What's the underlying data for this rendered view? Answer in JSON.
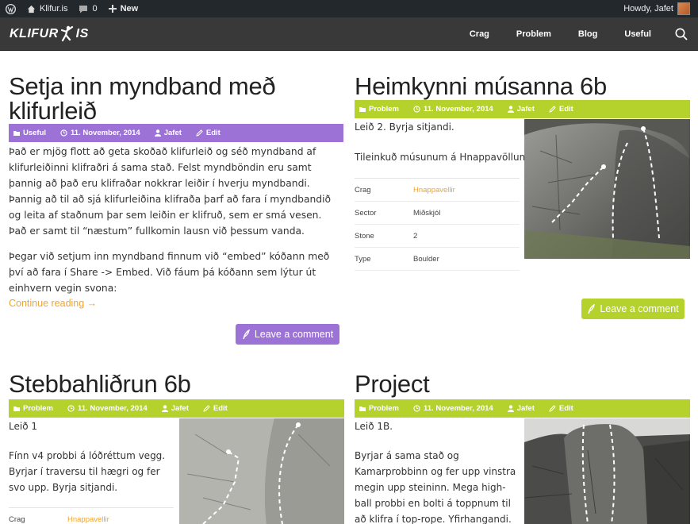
{
  "adminbar": {
    "site": "Klifur.is",
    "comments_count": "0",
    "new_label": "New",
    "greeting": "Howdy, Jafet"
  },
  "nav": {
    "logo_left": "KLIFUR",
    "logo_right": "IS",
    "items": [
      {
        "label": "Crag"
      },
      {
        "label": "Problem"
      },
      {
        "label": "Blog"
      },
      {
        "label": "Useful"
      }
    ]
  },
  "posts": [
    {
      "title": "Setja inn myndband með klifurleið",
      "category": "Useful",
      "date": "11. November, 2014",
      "author": "Jafet",
      "edit": "Edit",
      "paragraphs": [
        "Það er mjög flott að geta skoðað klifurleið og séð myndband af klifurleiðinni klifraðri á sama stað. Felst myndböndin eru samt þannig að það eru klifraðar nokkrar leiðir í hverju myndbandi. Þannig að til að sjá klifurleiðina klifraða þarf að fara í myndbandið og leita af staðnum þar sem leiðin er klifruð, sem er smá vesen. Það er samt til “næstum” fullkomin lausn við þessum vanda.",
        "Þegar við setjum inn myndband finnum við “embed” kóðann með því að fara í Share -> Embed. Við fáum þá kóðann sem lýtur út einhvern vegin svona:"
      ],
      "continue": "Continue reading →",
      "comment_button": "Leave a comment"
    },
    {
      "title": "Heimkynni músanna 6b",
      "category": "Problem",
      "date": "11. November, 2014",
      "author": "Jafet",
      "edit": "Edit",
      "paragraphs": [
        "Leið 2. Byrja sitjandi.",
        "Tileinkuð músunum á Hnappavöllum."
      ],
      "attributes": [
        {
          "key": "Crag",
          "value": "Hnappavellir"
        },
        {
          "key": "Sector",
          "value": "Miðskjól"
        },
        {
          "key": "Stone",
          "value": "2"
        },
        {
          "key": "Type",
          "value": "Boulder"
        }
      ],
      "comment_button": "Leave a comment"
    },
    {
      "title": "Stebbahliðrun 6b",
      "category": "Problem",
      "date": "11. November, 2014",
      "author": "Jafet",
      "edit": "Edit",
      "paragraphs": [
        "Leið 1",
        "Fínn v4 probbi á lóðréttum vegg. Byrjar í traversu til hægri og fer svo upp. Byrja sitjandi."
      ],
      "attributes": [
        {
          "key": "Crag",
          "value": "Hnappavellir"
        }
      ]
    },
    {
      "title": "Project",
      "category": "Problem",
      "date": "11. November, 2014",
      "author": "Jafet",
      "edit": "Edit",
      "paragraphs": [
        "Leið 1B.",
        "Byrjar á sama stað  og Kamarprobbinn og fer upp vinstra megin upp steininn. Mega high-ball probbi en bolti á toppnum til að klifra í top-rope. Yfirhangandi."
      ]
    }
  ],
  "colors": {
    "purple": "#9d72d6",
    "green": "#b5d12b",
    "link": "#f0a431",
    "nav": "#393939",
    "adminbar": "#23282d"
  }
}
